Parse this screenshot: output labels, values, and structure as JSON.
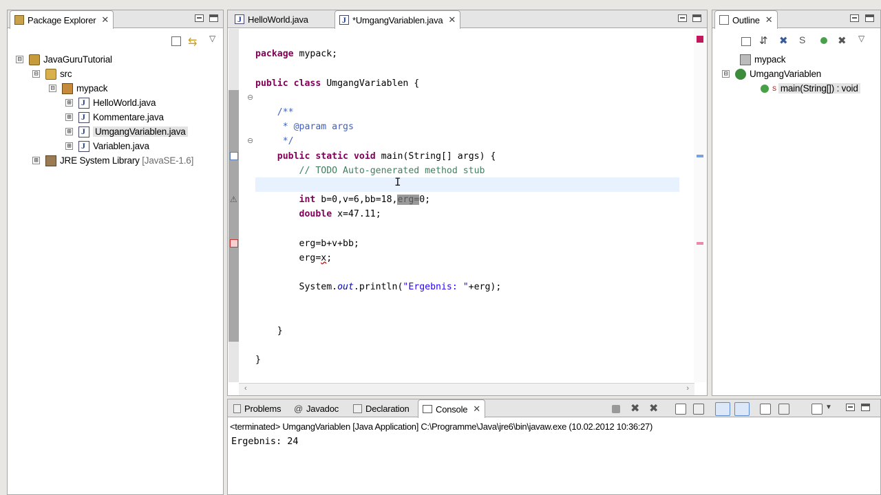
{
  "package_explorer": {
    "title": "Package Explorer",
    "tree": [
      {
        "label": "JavaGuruTutorial",
        "expander": "⊟",
        "icon": "project-icon"
      },
      {
        "label": "src",
        "expander": "⊟",
        "icon": "source-folder-icon"
      },
      {
        "label": "mypack",
        "expander": "⊟",
        "icon": "package-icon"
      },
      {
        "label": "HelloWorld.java",
        "expander": "⊞",
        "icon": "java-file-icon"
      },
      {
        "label": "Kommentare.java",
        "expander": "⊞",
        "icon": "java-file-icon"
      },
      {
        "label": "UmgangVariablen.java",
        "expander": "⊞",
        "icon": "java-file-icon",
        "selected": true
      },
      {
        "label": "Variablen.java",
        "expander": "⊞",
        "icon": "java-file-icon"
      },
      {
        "label": "JRE System Library",
        "suffix": "[JavaSE-1.6]",
        "expander": "⊞",
        "icon": "library-icon"
      }
    ]
  },
  "editor": {
    "tabs": [
      {
        "label": "HelloWorld.java"
      },
      {
        "label": "*UmgangVariablen.java",
        "active": true
      }
    ]
  },
  "outline": {
    "title": "Outline",
    "items": [
      {
        "label": "mypack"
      },
      {
        "label": "UmgangVariablen"
      },
      {
        "label": "main(String[]) : void",
        "superscript": "S"
      }
    ]
  },
  "bottom_panel": {
    "tabs": [
      {
        "label": "Problems"
      },
      {
        "label": "Javadoc"
      },
      {
        "label": "Declaration"
      },
      {
        "label": "Console",
        "active": true
      }
    ],
    "status": "<terminated> UmgangVariablen [Java Application] C:\\Programme\\Java\\jre6\\bin\\javaw.exe (10.02.2012 10:36:27)",
    "output": "Ergebnis: 24"
  },
  "colors": {
    "keyword": "#7f0055",
    "comment": "#3f7f5f",
    "javadoc": "#3f5fbf",
    "string": "#2a00ff"
  }
}
